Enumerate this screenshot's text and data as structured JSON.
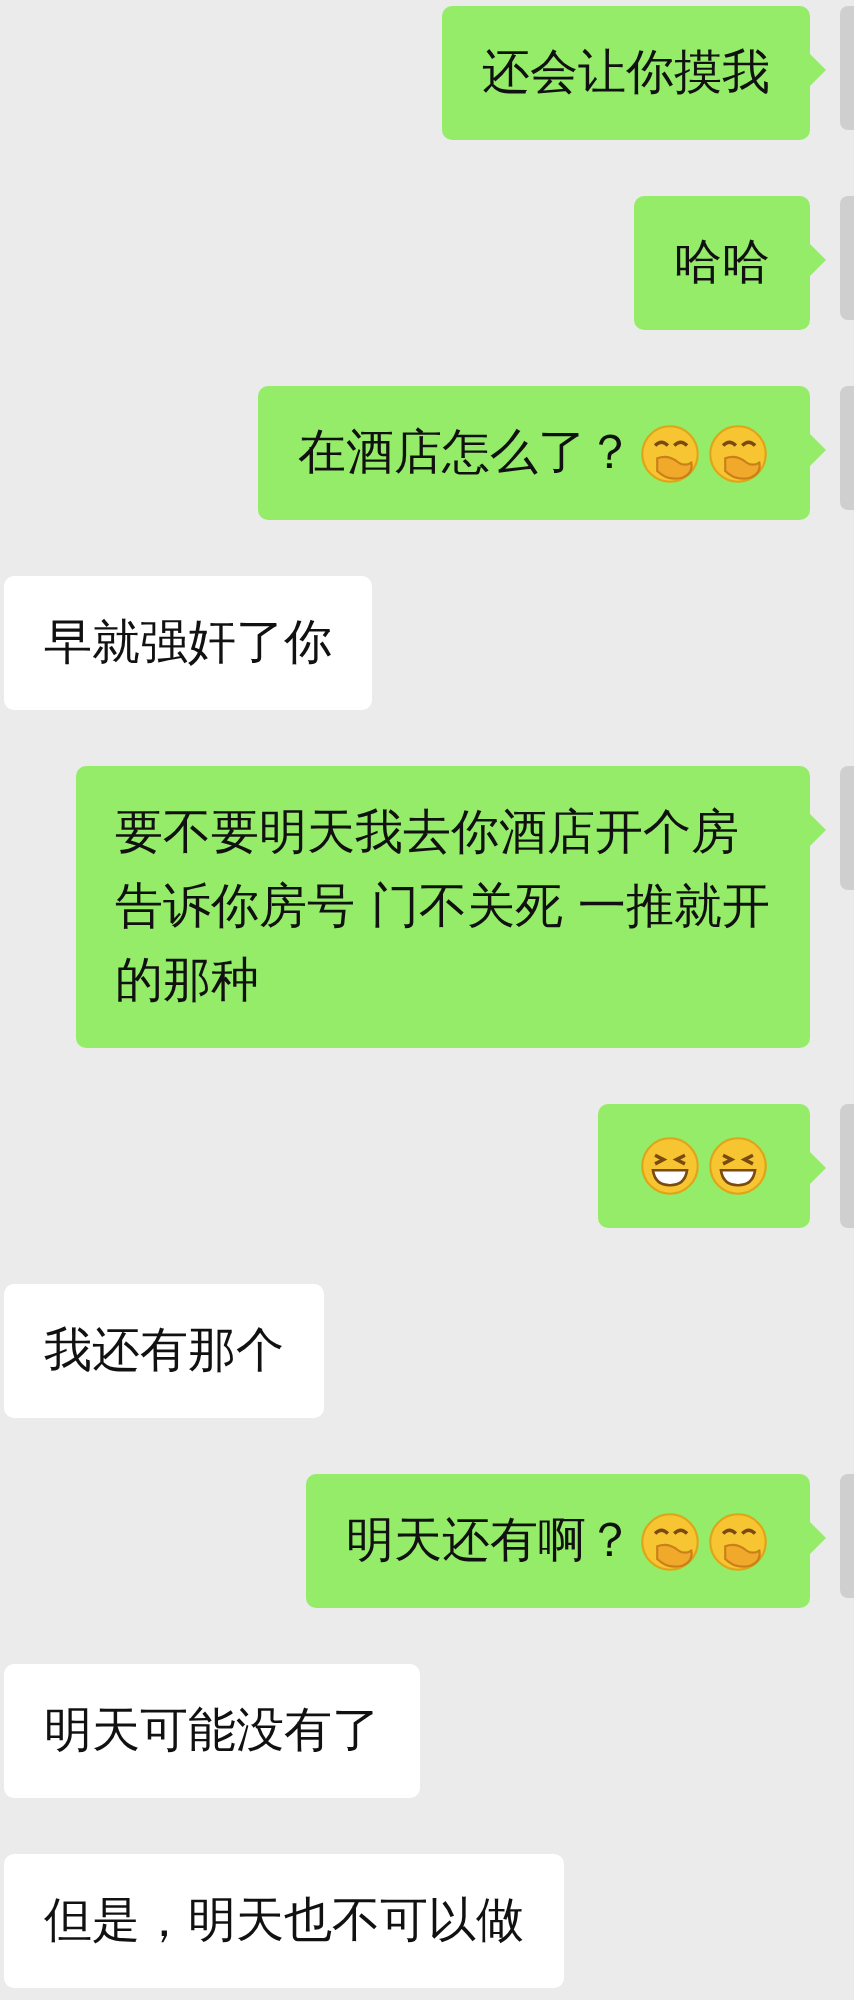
{
  "messages": [
    {
      "kind": "sent",
      "lines": [
        "还会让你摸我"
      ]
    },
    {
      "kind": "sent",
      "lines": [
        "哈哈"
      ]
    },
    {
      "kind": "sent",
      "lines": [
        "在酒店怎么了？"
      ],
      "emojis": [
        {
          "kind": "hand-over-mouth"
        },
        {
          "kind": "hand-over-mouth"
        }
      ]
    },
    {
      "kind": "received",
      "lines": [
        "早就强奸了你"
      ]
    },
    {
      "kind": "sent",
      "lines": [
        "要不要明天我去你酒店开个房",
        "告诉你房号 门不关死 一推就开",
        "的那种"
      ]
    },
    {
      "kind": "sent",
      "emojis": [
        {
          "kind": "grin"
        },
        {
          "kind": "grin"
        }
      ]
    },
    {
      "kind": "received",
      "lines": [
        "我还有那个"
      ]
    },
    {
      "kind": "sent",
      "lines": [
        "明天还有啊？"
      ],
      "emojis": [
        {
          "kind": "hand-over-mouth"
        },
        {
          "kind": "hand-over-mouth"
        }
      ]
    },
    {
      "kind": "received",
      "lines": [
        "明天可能没有了"
      ]
    },
    {
      "kind": "received",
      "lines": [
        "但是，明天也不可以做"
      ]
    }
  ]
}
